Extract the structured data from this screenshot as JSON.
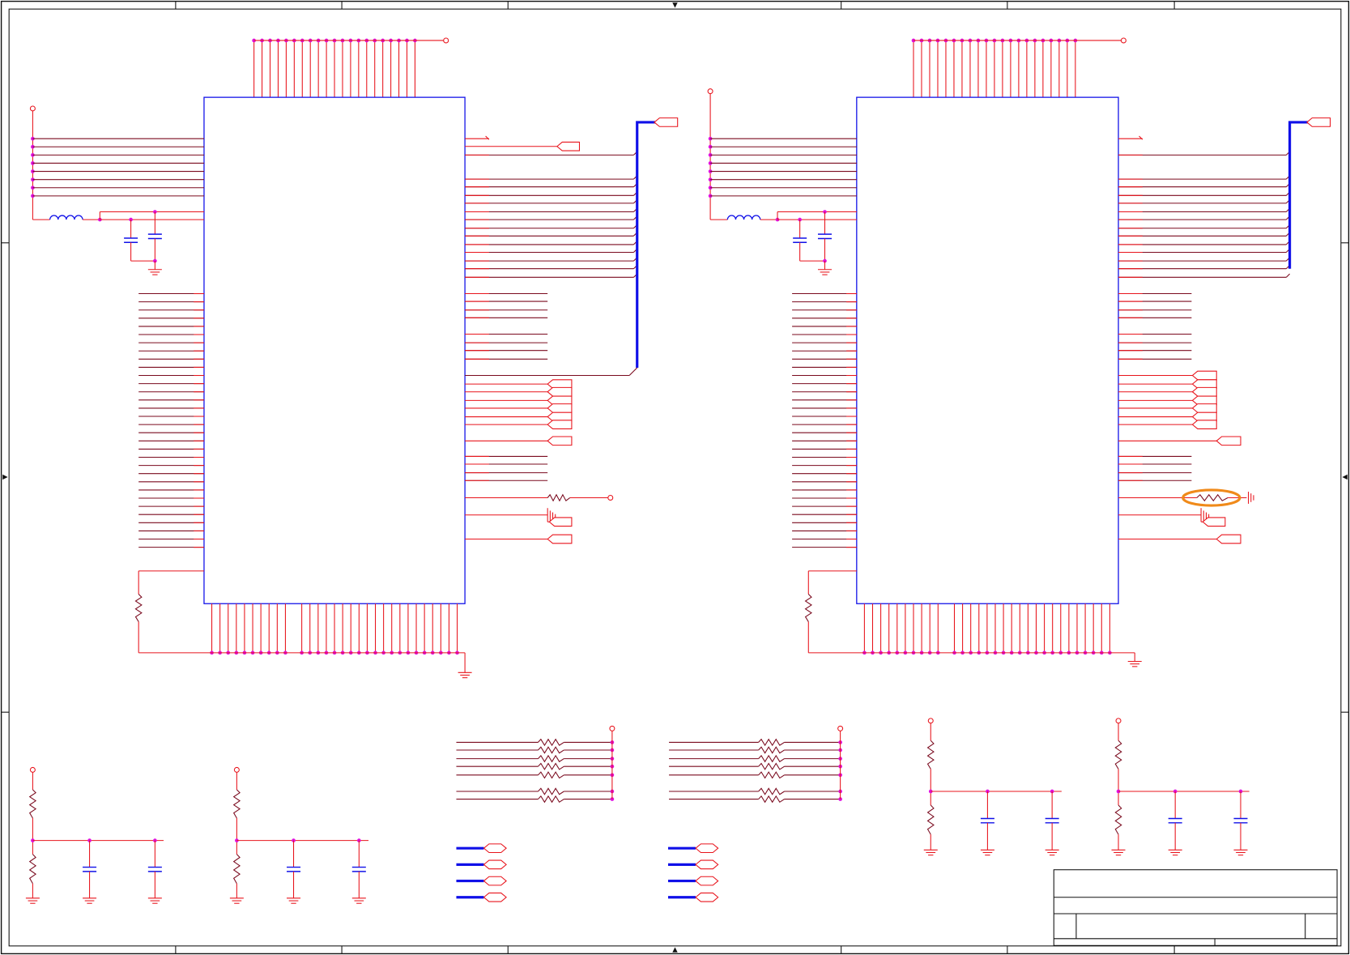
{
  "colors": {
    "wire": "#e8141c",
    "net": "#7a0a1e",
    "body": "#1010e8",
    "bus": "#1010e8",
    "junction": "#e010e0",
    "border": "#111111",
    "highlight": "#f08a1a",
    "background": "#ffffff"
  },
  "title_block": {},
  "sheet": {
    "zone_markers": "arrows"
  },
  "annotation": {
    "highlight_shape": "ellipse",
    "highlighted_component": "resistor-to-ground"
  }
}
